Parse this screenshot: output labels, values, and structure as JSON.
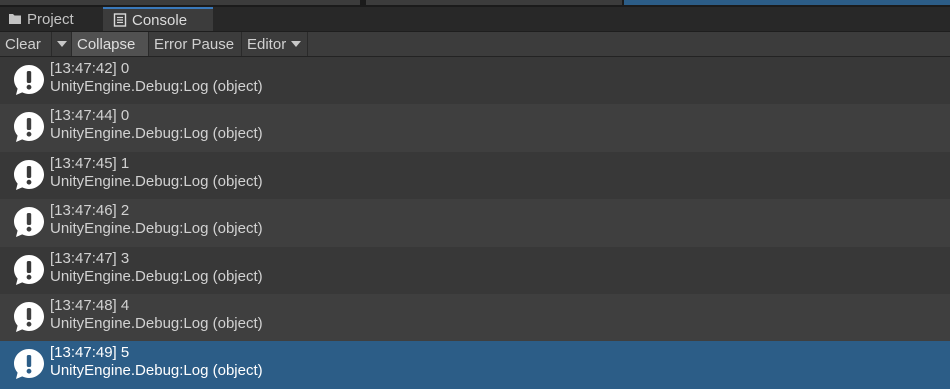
{
  "tabs": {
    "project_label": "Project",
    "console_label": "Console"
  },
  "toolbar": {
    "clear_label": "Clear",
    "collapse_label": "Collapse",
    "error_pause_label": "Error Pause",
    "editor_label": "Editor"
  },
  "colors": {
    "selected_row": "#2c5d87",
    "panel_bg": "#383838",
    "alt_row": "#3f3f3f",
    "icon_fill": "#ffffff"
  },
  "logs": [
    {
      "line1": "[13:47:42] 0",
      "line2": "UnityEngine.Debug:Log (object)",
      "icon": "info-bubble-icon"
    },
    {
      "line1": "[13:47:44] 0",
      "line2": "UnityEngine.Debug:Log (object)",
      "icon": "info-bubble-icon"
    },
    {
      "line1": "[13:47:45] 1",
      "line2": "UnityEngine.Debug:Log (object)",
      "icon": "info-bubble-icon"
    },
    {
      "line1": "[13:47:46] 2",
      "line2": "UnityEngine.Debug:Log (object)",
      "icon": "info-bubble-icon"
    },
    {
      "line1": "[13:47:47] 3",
      "line2": "UnityEngine.Debug:Log (object)",
      "icon": "info-bubble-icon"
    },
    {
      "line1": "[13:47:48] 4",
      "line2": "UnityEngine.Debug:Log (object)",
      "icon": "info-bubble-icon"
    },
    {
      "line1": "[13:47:49] 5",
      "line2": "UnityEngine.Debug:Log (object)",
      "icon": "info-bubble-icon",
      "selected": true
    }
  ]
}
